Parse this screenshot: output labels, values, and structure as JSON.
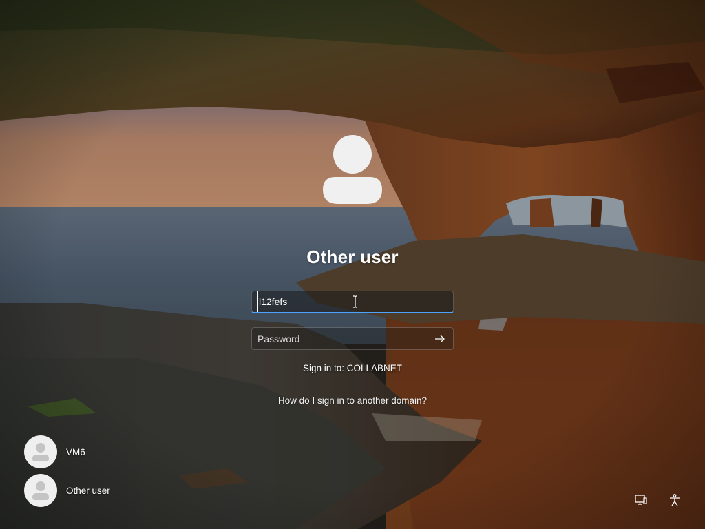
{
  "selected_user": {
    "name": "Other user",
    "avatar_icon": "user-silhouette-icon"
  },
  "username_field": {
    "value": "l12fefs"
  },
  "password_field": {
    "placeholder": "Password",
    "value": "",
    "submit_icon": "arrow-right-icon"
  },
  "sign_in_to": "Sign in to: COLLABNET",
  "other_domain_link": "How do I sign in to another domain?",
  "user_list": [
    {
      "label": "VM6",
      "icon": "user-silhouette-icon"
    },
    {
      "label": "Other user",
      "icon": "user-silhouette-icon"
    }
  ],
  "corner_icons": {
    "network": "network-icon",
    "accessibility": "accessibility-icon"
  },
  "colors": {
    "focus_accent": "#4ea3ff",
    "avatar_fill": "#efefef",
    "avatar_figure": "#c4c4c4"
  }
}
